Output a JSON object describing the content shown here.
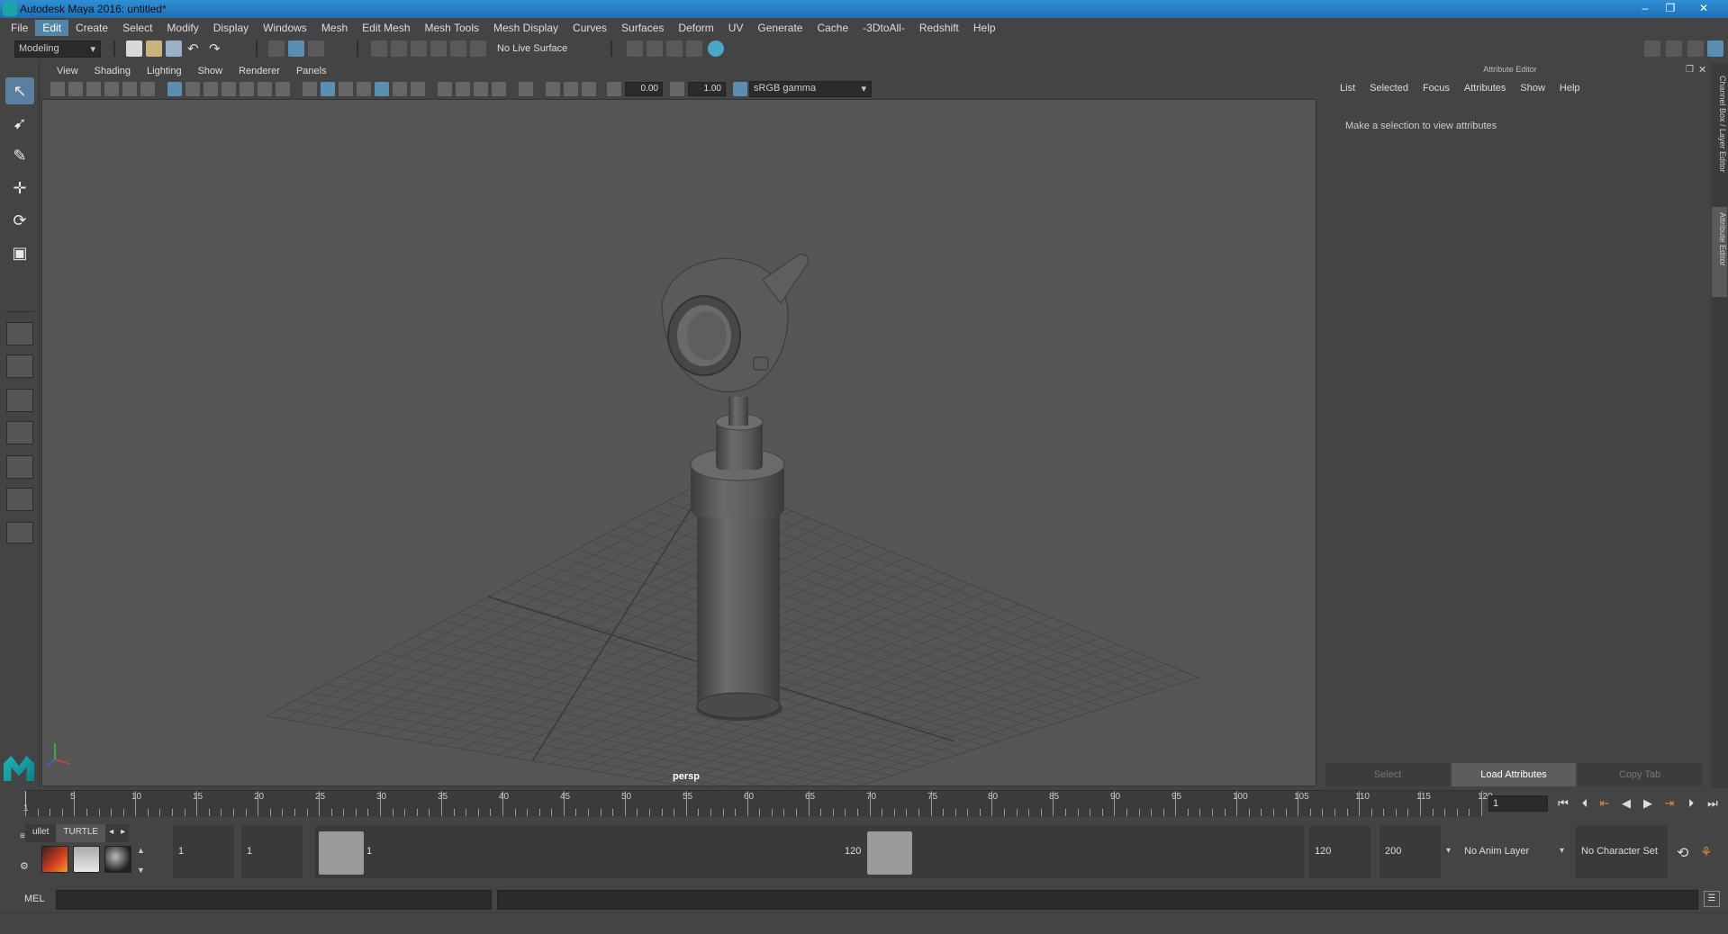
{
  "window": {
    "title": "Autodesk Maya 2016: untitled*"
  },
  "menubar": {
    "items": [
      "File",
      "Edit",
      "Create",
      "Select",
      "Modify",
      "Display",
      "Windows",
      "Mesh",
      "Edit Mesh",
      "Mesh Tools",
      "Mesh Display",
      "Curves",
      "Surfaces",
      "Deform",
      "UV",
      "Generate",
      "Cache",
      "-3DtoAll-",
      "Redshift",
      "Help"
    ],
    "active": "Edit"
  },
  "statusline": {
    "mode": "Modeling",
    "live_surface": "No Live Surface"
  },
  "viewport": {
    "menu": [
      "View",
      "Shading",
      "Lighting",
      "Show",
      "Renderer",
      "Panels"
    ],
    "exposure": "0.00",
    "gamma": "1.00",
    "colorspace": "sRGB gamma",
    "camera_label": "persp"
  },
  "attribute_editor": {
    "title": "Attribute Editor",
    "tabs": [
      "List",
      "Selected",
      "Focus",
      "Attributes",
      "Show",
      "Help"
    ],
    "message": "Make a selection to view attributes",
    "buttons": {
      "select": "Select",
      "load": "Load Attributes",
      "copy": "Copy Tab"
    },
    "side_tabs": [
      "Channel Box / Layer Editor",
      "Attribute Editor"
    ]
  },
  "timeslider": {
    "start_tick": "1",
    "labels": [
      "5",
      "10",
      "15",
      "20",
      "25",
      "30",
      "35",
      "40",
      "45",
      "50",
      "55",
      "60",
      "65",
      "70",
      "75",
      "80",
      "85",
      "90",
      "95",
      "100",
      "105",
      "110",
      "115",
      "120"
    ],
    "current_frame": "1"
  },
  "shelf": {
    "tabs": [
      "ullet",
      "TURTLE"
    ],
    "active": "TURTLE"
  },
  "range": {
    "start": "1",
    "playback_start": "1",
    "handle_start": "1",
    "handle_end": "120",
    "playback_end": "120",
    "end": "200",
    "anim_layer": "No Anim Layer",
    "character_set": "No Character Set"
  },
  "cmdline": {
    "label": "MEL"
  }
}
